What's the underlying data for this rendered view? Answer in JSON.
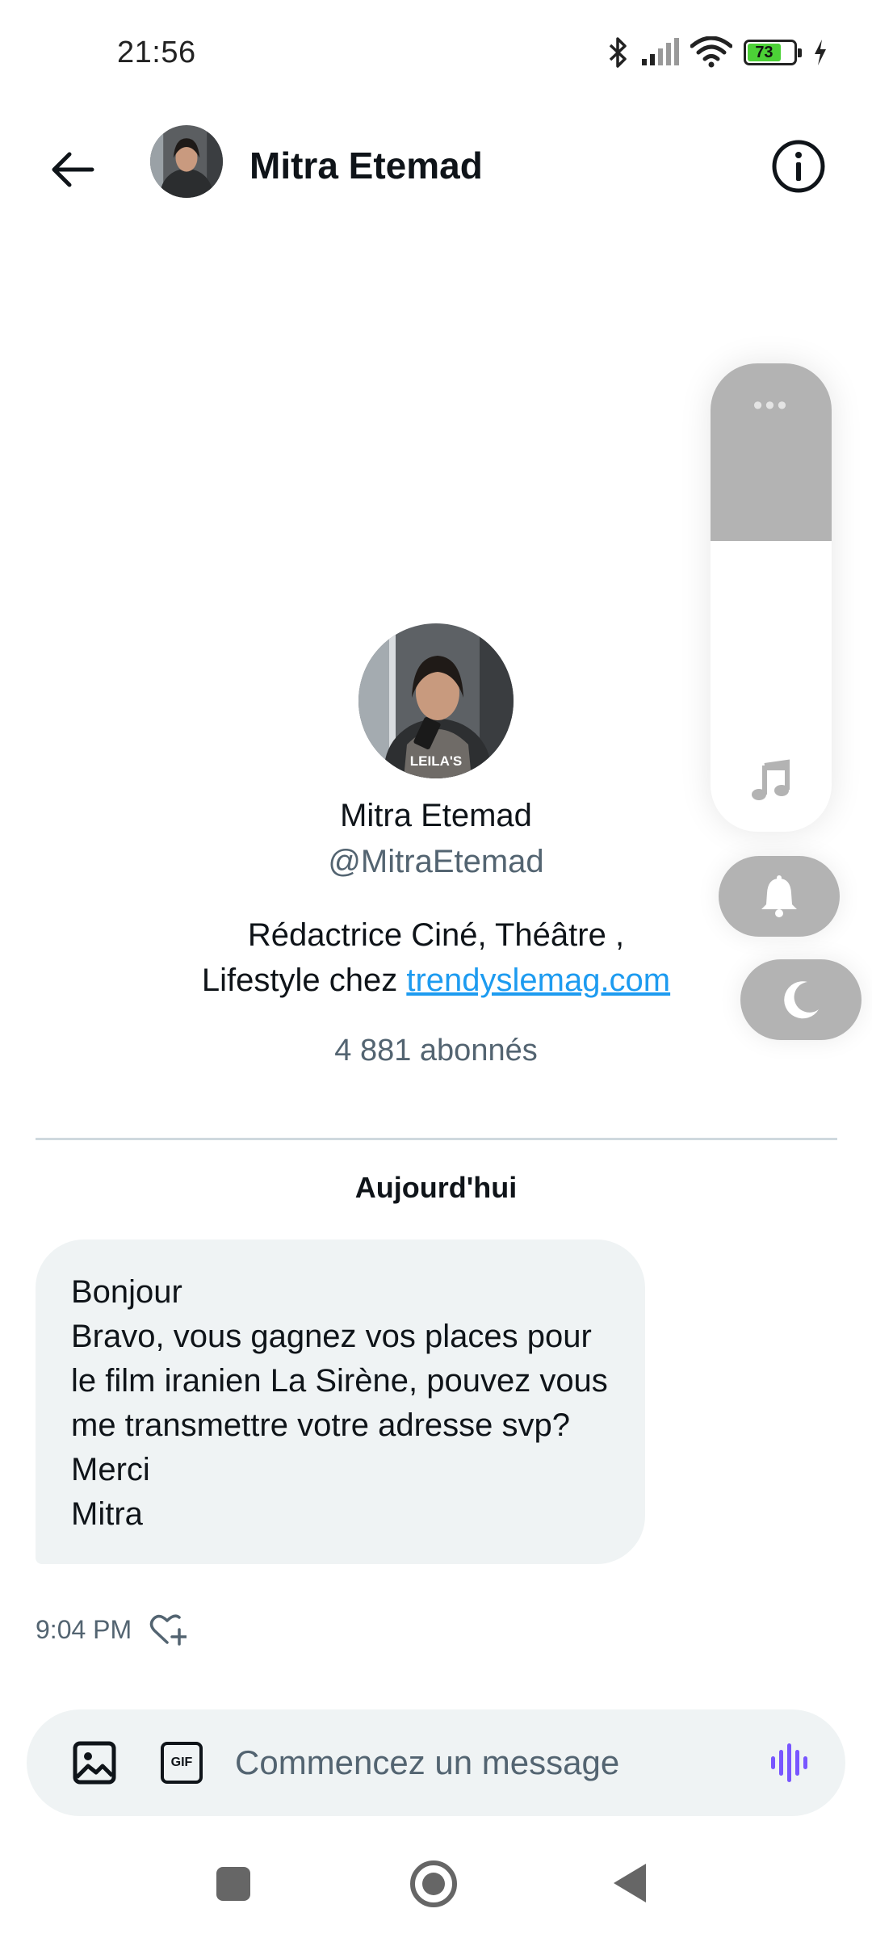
{
  "status_bar": {
    "time": "21:56",
    "battery_level": "73",
    "icons": [
      "bluetooth-icon",
      "signal-icon",
      "wifi-icon",
      "battery-icon",
      "charging-icon"
    ]
  },
  "header": {
    "title": "Mitra Etemad",
    "icons": [
      "back-arrow-icon",
      "info-icon"
    ]
  },
  "profile": {
    "name": "Mitra Etemad",
    "handle": "@MitraEtemad",
    "bio_line1": "Rédactrice Ciné, Théâtre ,",
    "bio_line2_prefix": "Lifestyle chez ",
    "bio_link": "trendyslemag.com",
    "followers": "4 881 abonnés",
    "avatar_text": "LEILA'S BROTHERS"
  },
  "conversation": {
    "date_label": "Aujourd'hui",
    "message_lines": [
      "Bonjour",
      "Bravo, vous gagnez vos places pour le film iranien La Sirène, pouvez vous me transmettre votre adresse svp?",
      "Merci",
      "Mitra"
    ],
    "time": "9:04 PM"
  },
  "composer": {
    "placeholder": "Commencez un message",
    "gif_label": "GIF"
  },
  "volume_overlay": {
    "media_volume_fraction": 0.62,
    "icons": [
      "more-dots-icon",
      "music-note-icon",
      "bell-icon",
      "moon-icon"
    ]
  },
  "colors": {
    "accent": "#1d9bf0",
    "voice_icon": "#7856ff",
    "bubble_bg": "#eff3f4",
    "secondary_text": "#536471"
  }
}
